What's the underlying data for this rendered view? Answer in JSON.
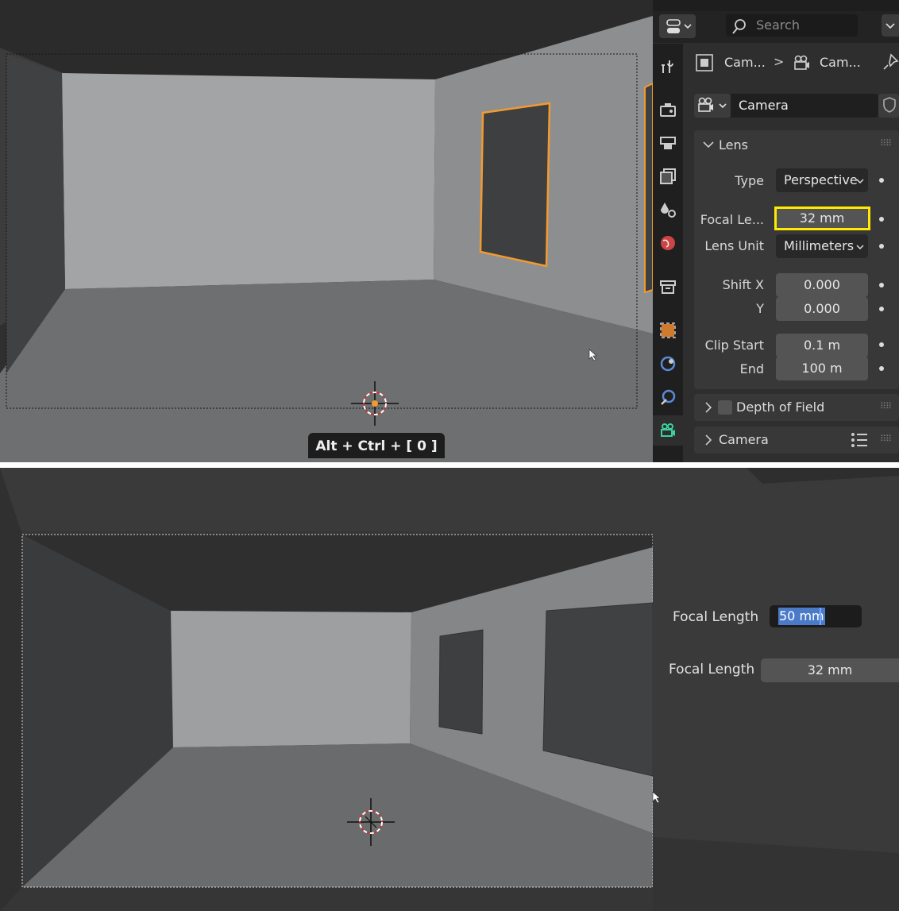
{
  "colors": {
    "selection_outline": "#f29a32",
    "highlight_box": "#ffea00",
    "camera_tab_accent": "#3ad0a0",
    "text_selection": "#4a7ac8"
  },
  "top": {
    "shortcut_overlay": "Alt + Ctrl + [ 0 ]",
    "header": {
      "search_placeholder": "Search",
      "breadcrumb_object": "Cam...",
      "breadcrumb_separator": ">",
      "breadcrumb_data": "Cam..."
    },
    "datablock_name": "Camera",
    "tabs": [
      {
        "icon": "tool-icon"
      },
      {
        "icon": "render-icon"
      },
      {
        "icon": "output-icon"
      },
      {
        "icon": "view-layer-icon"
      },
      {
        "icon": "scene-icon"
      },
      {
        "icon": "world-icon"
      },
      {
        "icon": "collection-icon"
      },
      {
        "icon": "object-icon"
      },
      {
        "icon": "modifier-icon"
      },
      {
        "icon": "constraint-icon"
      },
      {
        "icon": "camera-data-icon"
      }
    ],
    "lens_panel": {
      "title": "Lens",
      "type_label": "Type",
      "type_value": "Perspective",
      "focal_label": "Focal Le...",
      "focal_value": "32 mm",
      "lens_unit_label": "Lens Unit",
      "lens_unit_value": "Millimeters",
      "shift_x_label": "Shift X",
      "shift_x_value": "0.000",
      "shift_y_label": "Y",
      "shift_y_value": "0.000",
      "clip_start_label": "Clip Start",
      "clip_start_value": "0.1 m",
      "clip_end_label": "End",
      "clip_end_value": "100 m"
    },
    "dof_panel": {
      "title": "Depth of Field"
    },
    "camera_panel": {
      "title": "Camera"
    }
  },
  "bottom": {
    "focal_edit_label": "Focal Length",
    "focal_edit_value": "50 mm",
    "focal_label": "Focal Length",
    "focal_value": "32 mm"
  }
}
